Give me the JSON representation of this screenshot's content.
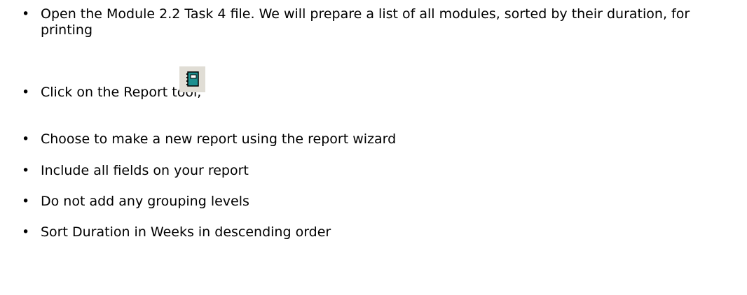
{
  "colors": {
    "text": "#000000",
    "tool_button_bg": "#e0ddd5",
    "report_icon_teal": "#1c8f8f"
  },
  "steps": [
    {
      "text": "Open the Module 2.2 Task 4 file. We will prepare a list of all modules, sorted by their duration, for printing"
    },
    {
      "text": "Click on the Report tool,",
      "icon": "report-tool-icon"
    },
    {
      "text": "Choose to make a new report using the report wizard"
    },
    {
      "text": "Include all fields on your report"
    },
    {
      "text": "Do not add any grouping levels"
    },
    {
      "text": "Sort Duration in Weeks in descending order"
    }
  ]
}
